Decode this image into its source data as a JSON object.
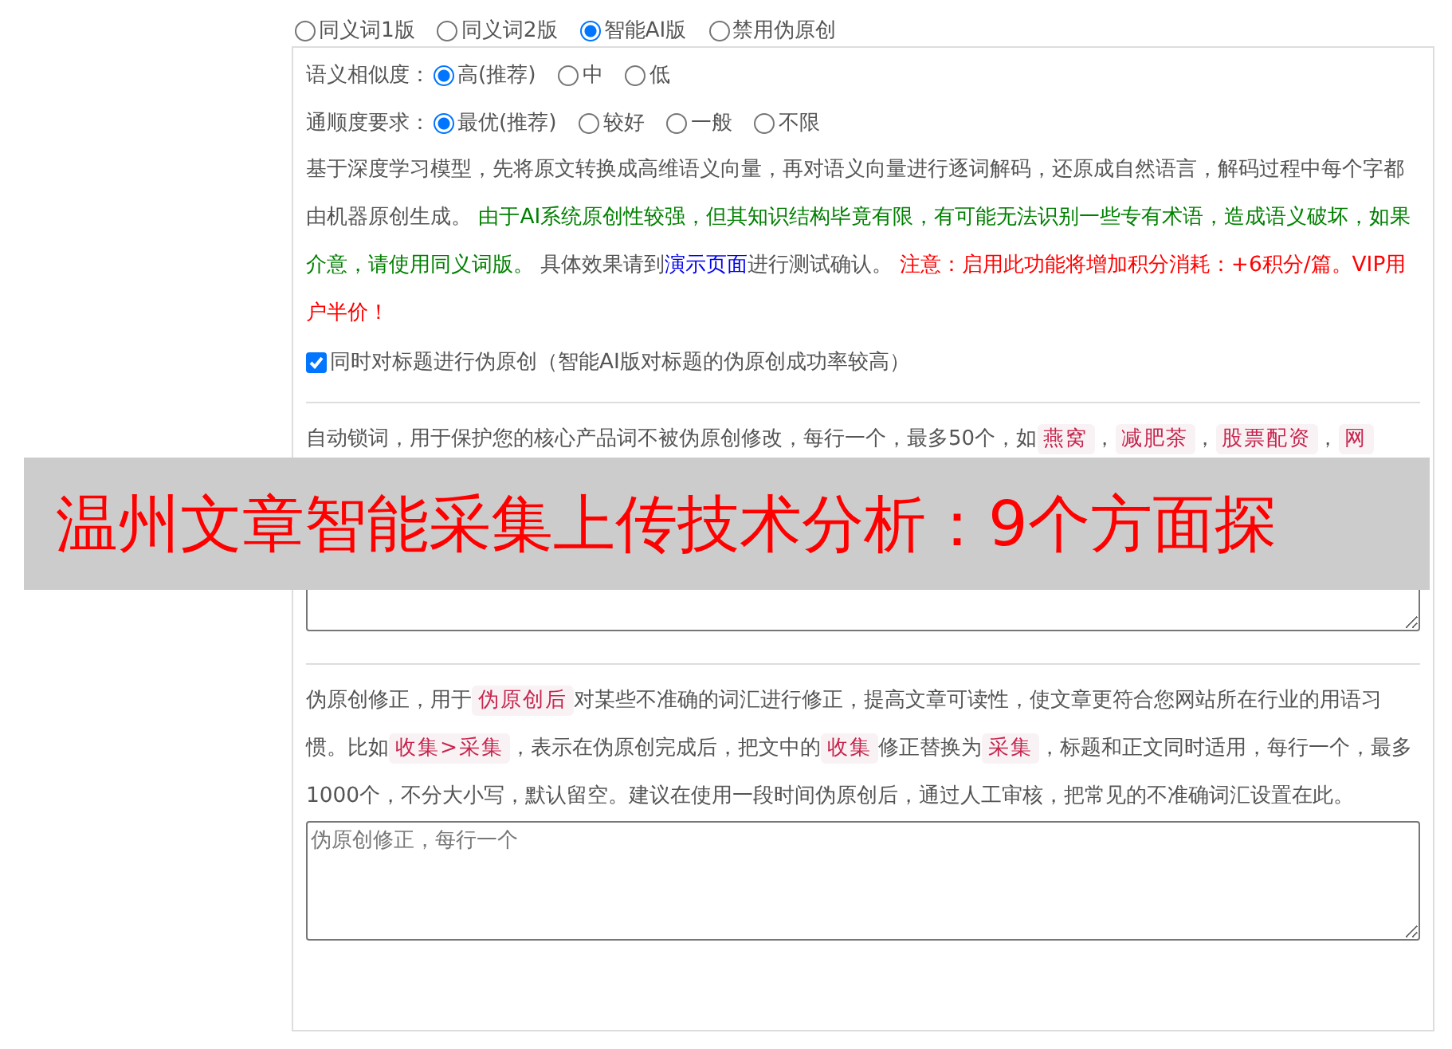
{
  "mode_options": [
    {
      "label": "同义词1版",
      "selected": false
    },
    {
      "label": "同义词2版",
      "selected": false
    },
    {
      "label": "智能AI版",
      "selected": true
    },
    {
      "label": "禁用伪原创",
      "selected": false
    }
  ],
  "similarity": {
    "label": "语义相似度：",
    "options": [
      {
        "label": "高(推荐)",
        "selected": true
      },
      {
        "label": "中",
        "selected": false
      },
      {
        "label": "低",
        "selected": false
      }
    ]
  },
  "fluency": {
    "label": "通顺度要求：",
    "options": [
      {
        "label": "最优(推荐)",
        "selected": true
      },
      {
        "label": "较好",
        "selected": false
      },
      {
        "label": "一般",
        "selected": false
      },
      {
        "label": "不限",
        "selected": false
      }
    ]
  },
  "description": [
    {
      "kind": "plain",
      "text": "基于深度学习模型，先将原文转换成高维语义向量，再对语义向量进行逐词解码，还原成自然语言，解码过程中每个字都由机器原创生成。 "
    },
    {
      "kind": "success",
      "text": "由于AI系统原创性较强，但其知识结构毕竟有限，有可能无法识别一些专有术语，造成语义破坏，如果介意，请使用同义词版。"
    },
    {
      "kind": "plain",
      "text": " 具体效果请到"
    },
    {
      "kind": "link",
      "text": "演示页面"
    },
    {
      "kind": "plain",
      "text": "进行测试确认。 "
    },
    {
      "kind": "warning",
      "text": "注意：启用此功能将增加积分消耗：+6积分/篇。VIP用户半价！"
    }
  ],
  "title_option": {
    "label": "同时对标题进行伪原创（智能AI版对标题的伪原创成功率较高）",
    "checked": true
  },
  "lock_words": {
    "description": [
      {
        "kind": "text",
        "text": "自动锁词，用于保护您的核心产品词不被伪原创修改，每行一个，最多50个，如"
      },
      {
        "kind": "tag",
        "text": "燕窝"
      },
      {
        "kind": "text",
        "text": "，"
      },
      {
        "kind": "tag",
        "text": "减肥茶"
      },
      {
        "kind": "text",
        "text": "，"
      },
      {
        "kind": "tag",
        "text": "股票配资"
      },
      {
        "kind": "text",
        "text": "，"
      },
      {
        "kind": "tag",
        "text": "网"
      }
    ]
  },
  "correction": {
    "description": [
      {
        "kind": "text",
        "text": "伪原创修正，用于"
      },
      {
        "kind": "tag",
        "text": "伪原创后"
      },
      {
        "kind": "text",
        "text": "对某些不准确的词汇进行修正，提高文章可读性，使文章更符合您网站所在行业的用语习惯。比如"
      },
      {
        "kind": "tag",
        "text": "收集>采集"
      },
      {
        "kind": "text",
        "text": "，表示在伪原创完成后，把文中的"
      },
      {
        "kind": "tag",
        "text": "收集"
      },
      {
        "kind": "text",
        "text": "修正替换为"
      },
      {
        "kind": "tag",
        "text": "采集"
      },
      {
        "kind": "text",
        "text": "，标题和正文同时适用，每行一个，最多1000个，不分大小写，默认留空。建议在使用一段时间伪原创后，通过人工审核，把常见的不准确词汇设置在此。"
      }
    ],
    "placeholder": "伪原创修正，每行一个"
  },
  "banner": {
    "text": "温州文章智能采集上传技术分析：9个方面探"
  }
}
